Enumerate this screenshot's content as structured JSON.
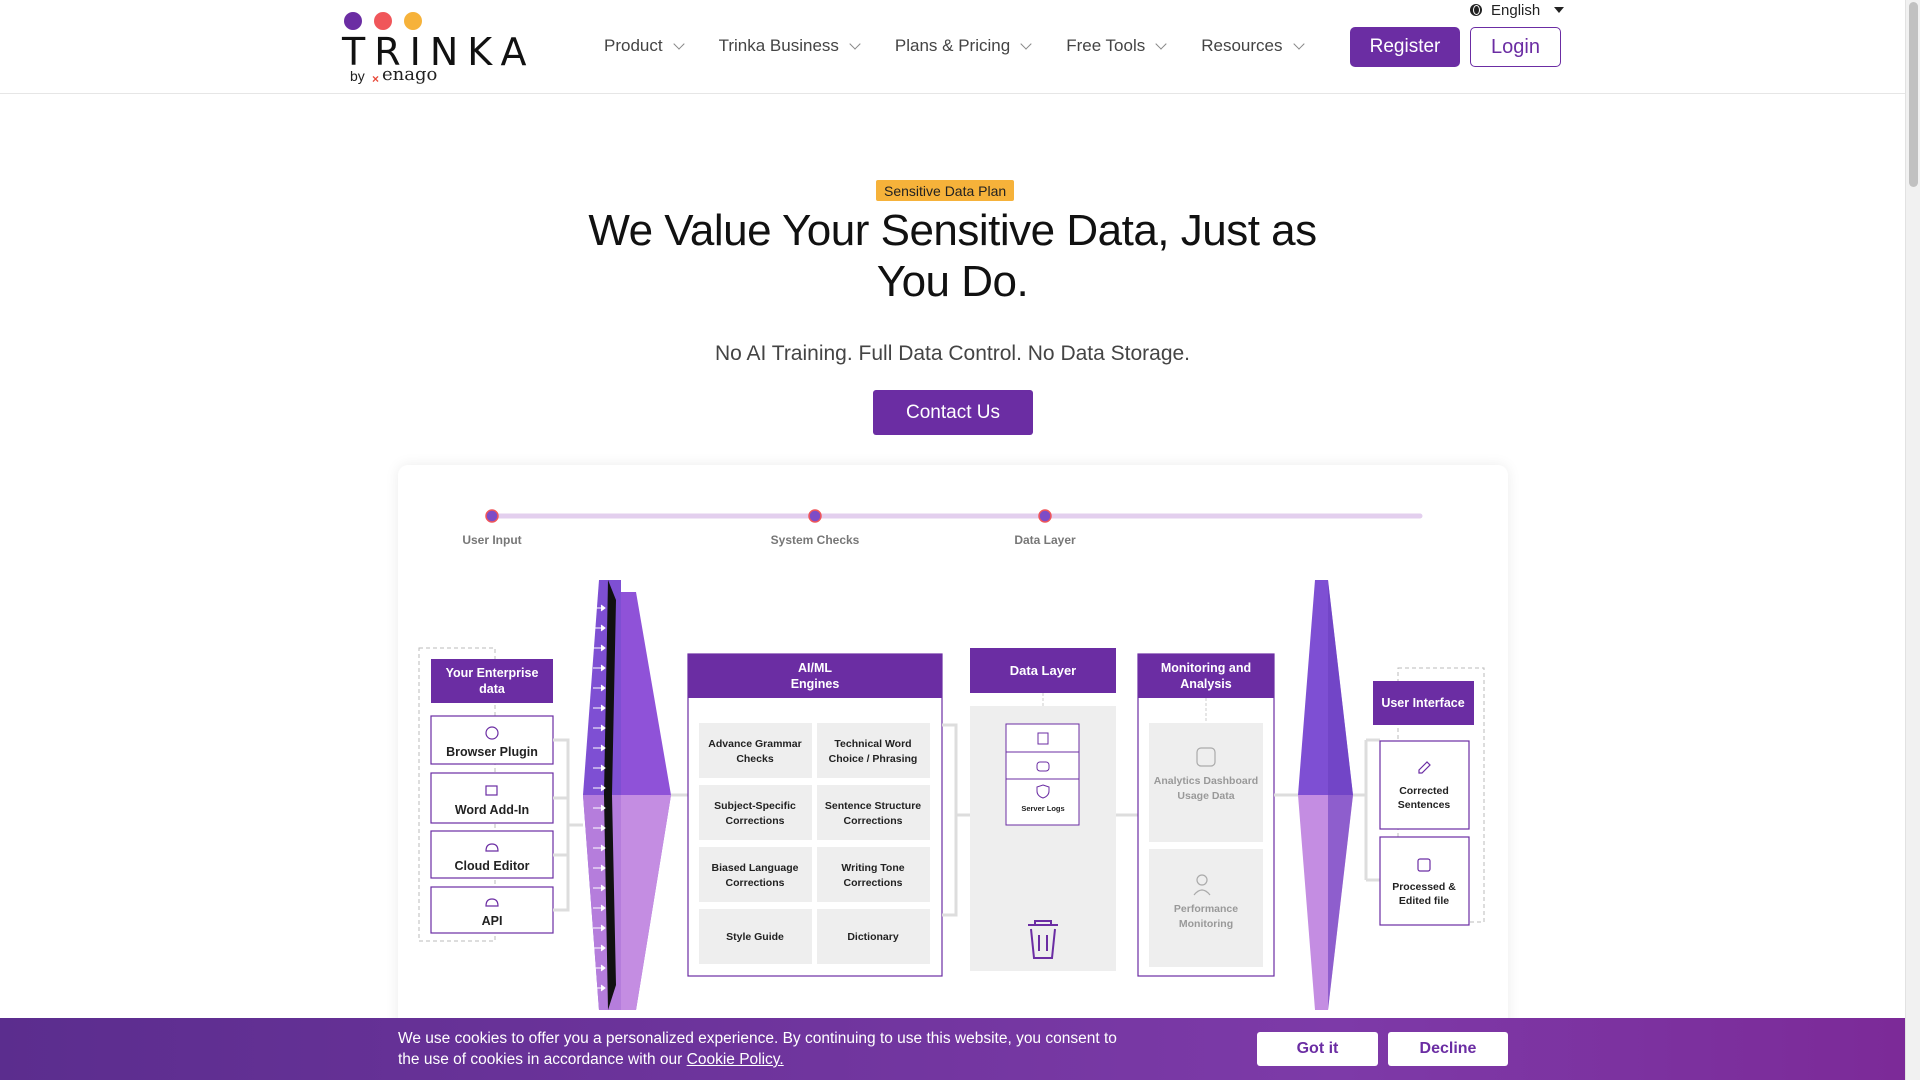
{
  "header": {
    "logo": {
      "word": "TRINKA",
      "by": "by",
      "enago": "enago"
    },
    "nav": [
      {
        "label": "Product"
      },
      {
        "label": "Trinka Business"
      },
      {
        "label": "Plans & Pricing"
      },
      {
        "label": "Free Tools"
      },
      {
        "label": "Resources"
      }
    ],
    "language": "English",
    "register_label": "Register",
    "login_label": "Login"
  },
  "hero": {
    "badge": "Sensitive Data Plan",
    "title": "We Value Your Sensitive Data, Just as You Do.",
    "subtitle": "No AI Training. Full Data Control. No Data Storage.",
    "contact_label": "Contact Us"
  },
  "diagram": {
    "timeline": [
      "User Input",
      "System Checks",
      "Data Layer"
    ],
    "enterprise": {
      "title": "Your Enterprise data",
      "items": [
        "Browser Plugin",
        "Word Add-In",
        "Cloud Editor",
        "API"
      ]
    },
    "engines": {
      "title": "AI/ML Engines",
      "items": [
        "Advance Grammar Checks",
        "Technical Word Choice / Phrasing",
        "Subject-Specific Corrections",
        "Sentence Structure Corrections",
        "Biased Language Corrections",
        "Writing Tone Corrections",
        "Style Guide",
        "Dictionary"
      ]
    },
    "data_layer": {
      "title": "Data Layer",
      "server_logs": "Server Logs"
    },
    "monitoring": {
      "title": "Monitoring and Analysis",
      "items": [
        "Analytics Dashboard Usage Data",
        "Performance Monitoring"
      ]
    },
    "ui": {
      "title": "User Interface",
      "items": [
        "Corrected Sentences",
        "Processed & Edited file"
      ]
    }
  },
  "cookie": {
    "text": "We use cookies to offer you a personalized experience. By continuing to use this website, you consent to the use of cookies in accordance with our ",
    "link": "Cookie Policy.",
    "got_it": "Got it",
    "decline": "Decline"
  },
  "colors": {
    "brand": "#6b2da3",
    "accent": "#f6b23a",
    "dot_purple": "#6b2da3",
    "dot_red": "#f0565a",
    "dot_orange": "#f6b23a"
  }
}
